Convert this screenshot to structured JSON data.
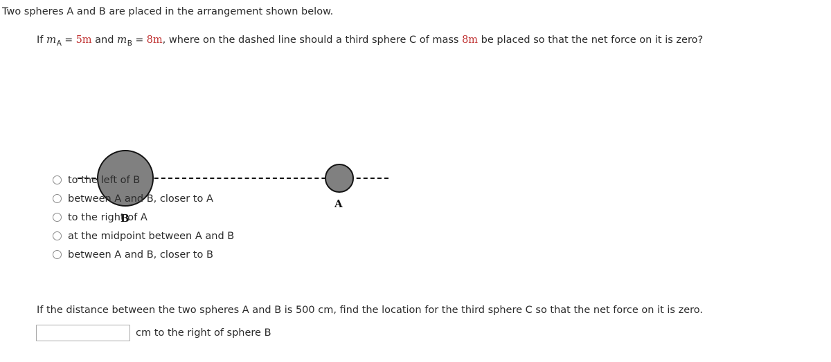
{
  "intro": {
    "text": "Two spheres A and B are placed in the arrangement shown below."
  },
  "question": {
    "prefix": "If ",
    "var_m1": "m",
    "sub_a": "A",
    "eq1": " = ",
    "value_a": "5m",
    "middle": " and ",
    "var_m2": "m",
    "sub_b": "B",
    "eq2": " = ",
    "value_b": "8m",
    "suffix": ", where on the dashed line should a third sphere C of mass ",
    "mass_c": "8m",
    "tail": " be placed so that the net force on it is zero?"
  },
  "diagram": {
    "sphere_b_label": "B",
    "sphere_a_label": "A",
    "line_style": "dashed",
    "sphere_fill_color": "#808080",
    "sphere_stroke_color": "#141414"
  },
  "options": [
    {
      "label": "to the left of B",
      "selected": false
    },
    {
      "label": "between A and B, closer to A",
      "selected": false
    },
    {
      "label": "to the right of A",
      "selected": false
    },
    {
      "label": "at the midpoint between A and B",
      "selected": false
    },
    {
      "label": "between A and B, closer to B",
      "selected": false
    }
  ],
  "bottom": {
    "question": "If the distance between the two spheres A and B is 500 cm, find the location for the third sphere C so that the net force on it is zero.",
    "input_value": "",
    "input_placeholder": "",
    "unit_text": "cm to the right of sphere B"
  },
  "colors": {
    "red_accent": "#bf3030",
    "text": "#2b2b2b"
  }
}
